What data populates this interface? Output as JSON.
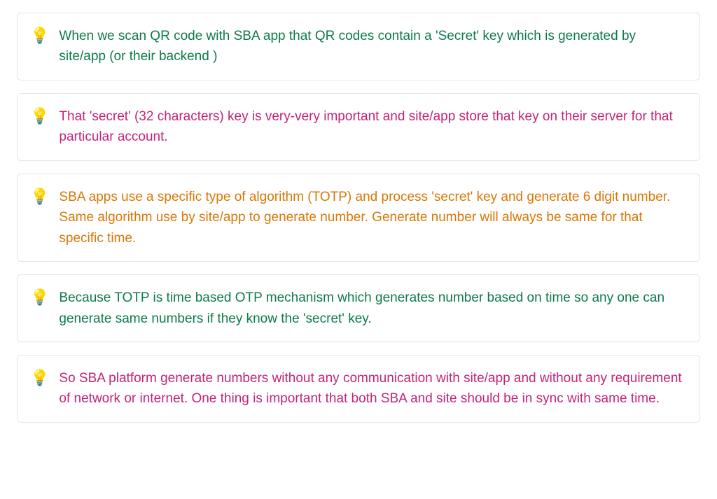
{
  "callouts": [
    {
      "icon": "💡",
      "colorClass": "c-green",
      "text": "When we scan QR code with SBA app that QR codes contain a 'Secret' key which is generated by site/app (or their backend )"
    },
    {
      "icon": "💡",
      "colorClass": "c-pink",
      "text": "That 'secret' (32 characters) key is very-very important and site/app store that key on their server for that particular account."
    },
    {
      "icon": "💡",
      "colorClass": "c-orange",
      "text": "SBA apps use a specific type of algorithm (TOTP) and process 'secret' key and generate 6 digit number. Same algorithm use by site/app to generate number. Generate number will always be same for that specific time."
    },
    {
      "icon": "💡",
      "colorClass": "c-green",
      "text": "Because TOTP is time based OTP mechanism which generates number based on time so any one can generate same numbers if they know the 'secret' key."
    },
    {
      "icon": "💡",
      "colorClass": "c-pink",
      "text": "So SBA platform generate numbers without any communication with site/app and without any requirement of network or internet. One thing is important that both SBA and site should be in sync with same time."
    }
  ]
}
